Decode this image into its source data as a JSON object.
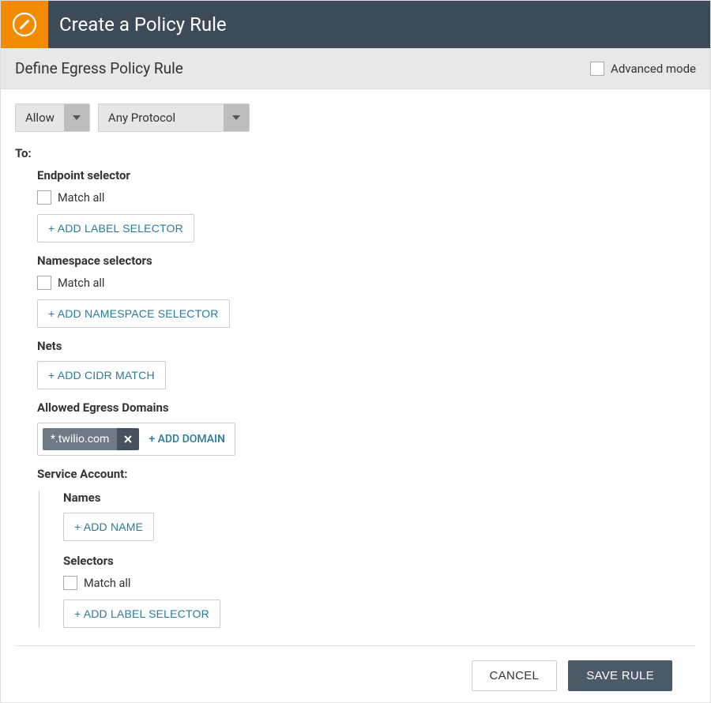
{
  "header": {
    "title": "Create a Policy Rule"
  },
  "subheader": {
    "title": "Define Egress Policy Rule",
    "advanced_label": "Advanced mode"
  },
  "action_select": {
    "value": "Allow"
  },
  "protocol_select": {
    "value": "Any Protocol"
  },
  "to_label": "To:",
  "endpoint_selector": {
    "title": "Endpoint selector",
    "match_all_label": "Match all",
    "add_button": "+ ADD LABEL SELECTOR"
  },
  "namespace_selectors": {
    "title": "Namespace selectors",
    "match_all_label": "Match all",
    "add_button": "+ ADD NAMESPACE SELECTOR"
  },
  "nets": {
    "title": "Nets",
    "add_button": "+ ADD CIDR MATCH"
  },
  "domains": {
    "title": "Allowed Egress Domains",
    "chip": "*.twilio.com",
    "add_link": "+ ADD DOMAIN"
  },
  "service_account": {
    "title": "Service Account:",
    "names": {
      "title": "Names",
      "add_button": "+ ADD NAME"
    },
    "selectors": {
      "title": "Selectors",
      "match_all_label": "Match all",
      "add_button": "+ ADD LABEL SELECTOR"
    }
  },
  "footer": {
    "cancel": "CANCEL",
    "save": "SAVE RULE"
  }
}
